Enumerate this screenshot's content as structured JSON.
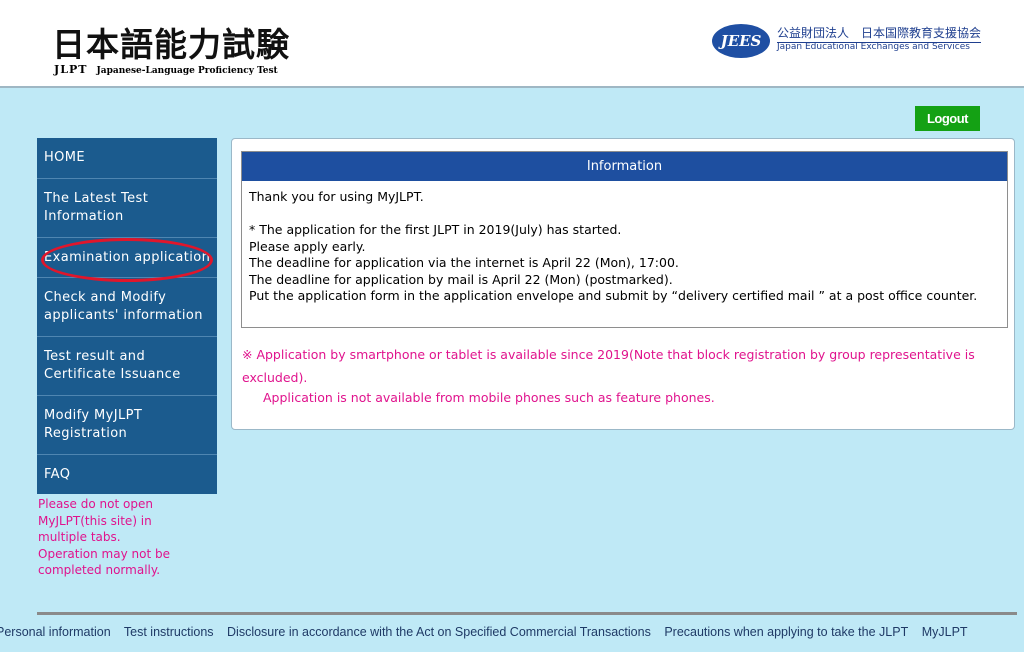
{
  "header": {
    "title_ja": "日本語能力試験",
    "jlpt": "JLPT",
    "title_en": "Japanese-Language Proficiency Test",
    "org_badge": "JEES",
    "org_ja": "公益財団法人　日本国際教育支援協会",
    "org_en": "Japan Educational Exchanges and Services"
  },
  "logout_label": "Logout",
  "sidebar": {
    "items": [
      {
        "label": "HOME"
      },
      {
        "label": "The Latest Test\nInformation"
      },
      {
        "label": "Examination application"
      },
      {
        "label": "Check and Modify\napplicants' information"
      },
      {
        "label": "Test result and\nCertificate Issuance"
      },
      {
        "label": "Modify MyJLPT\nRegistration"
      },
      {
        "label": "FAQ"
      }
    ],
    "warning": "Please do not open\nMyJLPT(this site) in\nmultiple tabs.\nOperation may not be\ncompleted normally."
  },
  "info": {
    "heading": "Information",
    "lines": [
      "Thank you for using MyJLPT.",
      "",
      "* The application for the first JLPT in 2019(July) has started.",
      "Please apply early.",
      "The deadline for application via the internet is April 22 (Mon), 17:00.",
      "The deadline for application by mail is April 22 (Mon) (postmarked).",
      "Put the application form in the application envelope and submit by “delivery certified mail ” at a post office counter."
    ]
  },
  "notice": {
    "main": "※ Application by smartphone or tablet is available since 2019(Note that block registration by group representative is excluded).",
    "sub": "Application is not available from mobile phones such as feature phones."
  },
  "footer": {
    "links": [
      "Personal information",
      "Test instructions",
      "Disclosure in accordance with the Act on Specified Commercial Transactions",
      "Precautions when applying to take the JLPT",
      "MyJLPT"
    ]
  },
  "colors": {
    "background": "#bfe9f6",
    "sidebar": "#1b5b8e",
    "info_header": "#1e4fa0",
    "logout": "#14a114",
    "notice": "#e0138d",
    "highlight_circle": "#e0162b"
  }
}
